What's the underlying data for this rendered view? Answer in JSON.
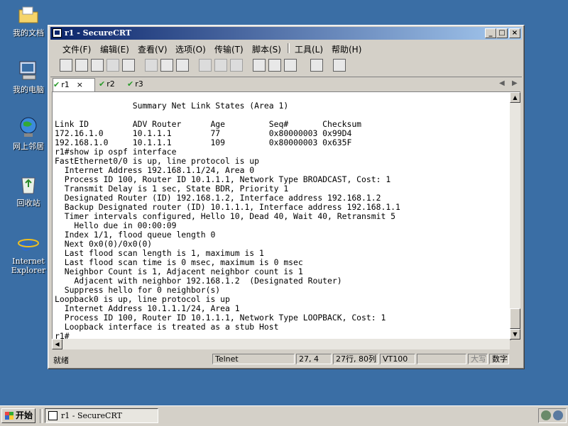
{
  "desktop": {
    "icons": [
      {
        "label": "我的文档",
        "icon": "folder-icon"
      },
      {
        "label": "我的电脑",
        "icon": "computer-icon"
      },
      {
        "label": "网上邻居",
        "icon": "network-icon"
      },
      {
        "label": "回收站",
        "icon": "recycle-bin-icon"
      },
      {
        "label": "Internet Explorer",
        "icon": "ie-icon"
      }
    ]
  },
  "window": {
    "title": "r1 - SecureCRT",
    "controls": {
      "minimize": "_",
      "maximize": "□",
      "close": "×"
    }
  },
  "menu": {
    "file": "文件(F)",
    "edit": "编辑(E)",
    "view": "查看(V)",
    "options": "选项(O)",
    "transfer": "传输(T)",
    "script": "脚本(S)",
    "tools": "工具(L)",
    "help": "帮助(H)"
  },
  "tabs": [
    {
      "label": "r1",
      "active": true,
      "close": "×"
    },
    {
      "label": "r2",
      "active": false
    },
    {
      "label": "r3",
      "active": false
    }
  ],
  "terminal": {
    "lines": "\n                Summary Net Link States (Area 1)\n\nLink ID         ADV Router      Age         Seq#       Checksum\n172.16.1.0      10.1.1.1        77          0x80000003 0x99D4\n192.168.1.0     10.1.1.1        109         0x80000003 0x635F\nr1#show ip ospf interface\nFastEthernet0/0 is up, line protocol is up\n  Internet Address 192.168.1.1/24, Area 0\n  Process ID 100, Router ID 10.1.1.1, Network Type BROADCAST, Cost: 1\n  Transmit Delay is 1 sec, State BDR, Priority 1\n  Designated Router (ID) 192.168.1.2, Interface address 192.168.1.2\n  Backup Designated router (ID) 10.1.1.1, Interface address 192.168.1.1\n  Timer intervals configured, Hello 10, Dead 40, Wait 40, Retransmit 5\n    Hello due in 00:00:09\n  Index 1/1, flood queue length 0\n  Next 0x0(0)/0x0(0)\n  Last flood scan length is 1, maximum is 1\n  Last flood scan time is 0 msec, maximum is 0 msec\n  Neighbor Count is 1, Adjacent neighbor count is 1\n    Adjacent with neighbor 192.168.1.2  (Designated Router)\n  Suppress hello for 0 neighbor(s)\nLoopback0 is up, line protocol is up\n  Internet Address 10.1.1.1/24, Area 1\n  Process ID 100, Router ID 10.1.1.1, Network Type LOOPBACK, Cost: 1\n  Loopback interface is treated as a stub Host\nr1#"
  },
  "status": {
    "ready": "就绪",
    "protocol": "Telnet",
    "cursor": "27,  4",
    "size": "27行, 80列",
    "emulation": "VT100",
    "caps": "大写",
    "num": "数字"
  },
  "taskbar": {
    "start": "开始",
    "task": "r1 - SecureCRT"
  }
}
